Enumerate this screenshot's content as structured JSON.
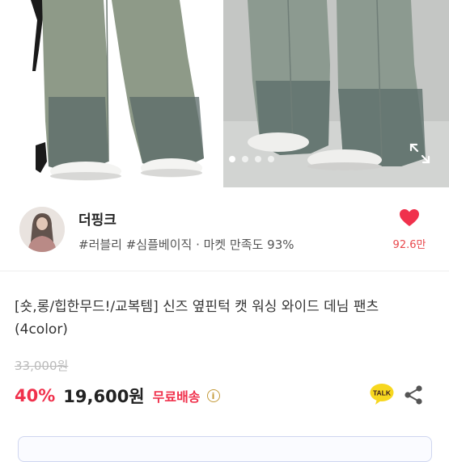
{
  "gallery": {
    "dot_count": 4,
    "active_dot": 1,
    "expand_icon": "expand-icon"
  },
  "seller": {
    "name": "더핑크",
    "tags": "#러블리 #심플베이직 · 마켓 만족도 93%",
    "likes": "92.6만",
    "like_icon": "heart-icon",
    "like_color": "#f0314c"
  },
  "product": {
    "title": "[숏,롱/힙한무드!/교복템] 신즈 옆핀턱 캣 워싱 와이드 데님 팬츠 (4color)",
    "original_price": "33,000원",
    "discount": "40%",
    "price": "19,600원",
    "shipping": "무료배송",
    "info_icon": "i",
    "talk_label": "TALK",
    "share_icon": "share-icon"
  },
  "colors": {
    "accent": "#f0314c",
    "kakao": "#f7d71f"
  }
}
